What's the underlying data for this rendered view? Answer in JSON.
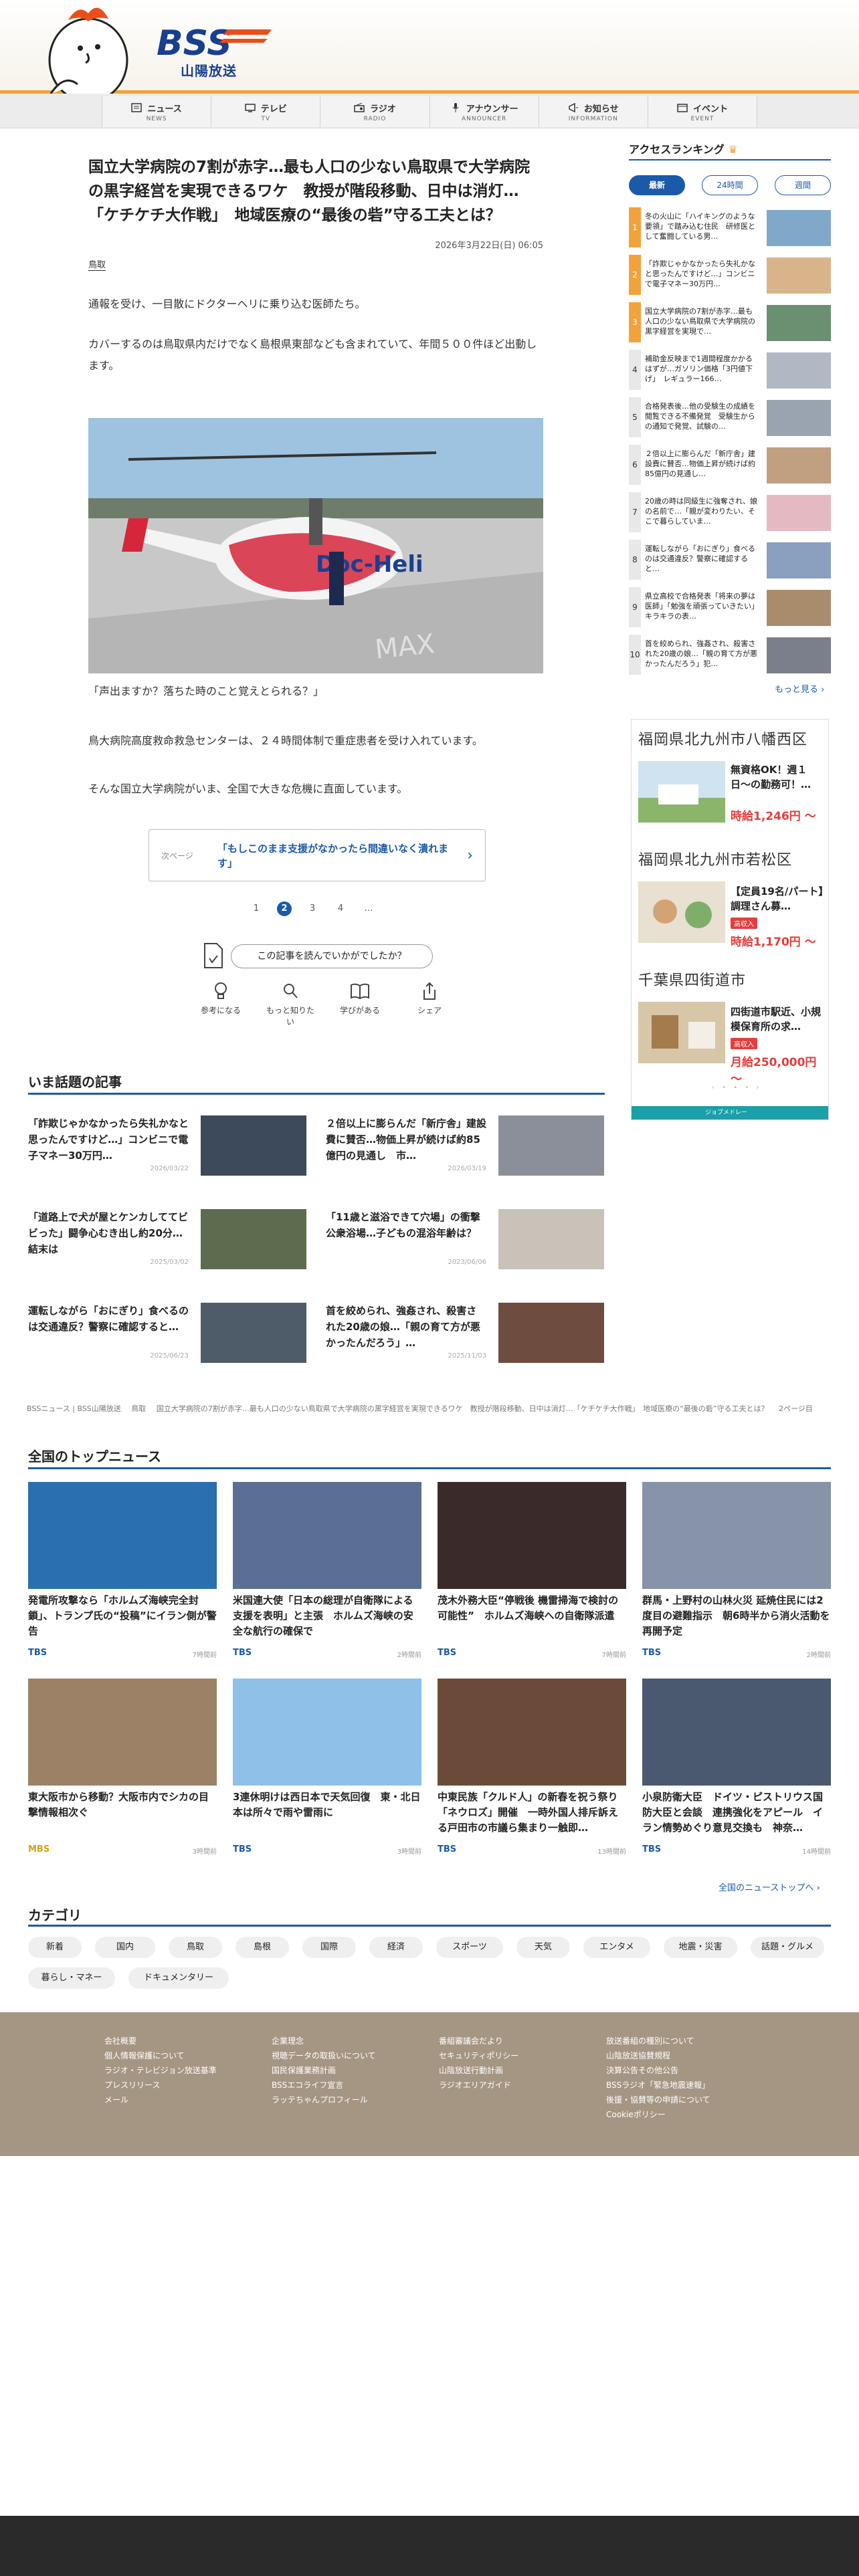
{
  "brand": {
    "station_name": "山陽放送",
    "logo_text": "BSS"
  },
  "nav": {
    "items": [
      {
        "label": "ニュース",
        "sub": "NEWS",
        "icon": "news-icon"
      },
      {
        "label": "テレビ",
        "sub": "TV",
        "icon": "tv-icon"
      },
      {
        "label": "ラジオ",
        "sub": "RADIO",
        "icon": "radio-icon"
      },
      {
        "label": "アナウンサー",
        "sub": "ANNOUNCER",
        "icon": "mic-icon"
      },
      {
        "label": "お知らせ",
        "sub": "INFORMATION",
        "icon": "megaphone-icon"
      },
      {
        "label": "イベント",
        "sub": "EVENT",
        "icon": "calendar-icon"
      }
    ]
  },
  "article": {
    "title": "国立大学病院の7割が赤字…最も人口の少ない鳥取県で大学病院の黒字経営を実現できるワケ　教授が階段移動、日中は消灯…「ケチケチ大作戦」　地域医療の“最後の砦”守る工夫とは？",
    "date": "2026年3月22日(日) 06:05",
    "category": "鳥取",
    "paragraphs": [
      "通報を受け、一目散にドクターヘリに乗り込む医師たち。",
      "カバーするのは鳥取県内だけでなく島根県東部なども含まれていて、年間５００件ほど出動します。"
    ],
    "caption": "「声出ますか？落ちた時のこと覚えとられる？」",
    "paragraphs2": [
      "鳥大病院高度救命救急センターは、２４時間体制で重症患者を受け入れています。",
      "そんな国立大学病院がいま、全国で大きな危機に直面しています。"
    ],
    "next_label": "次ページ",
    "next_text": "「もしこのまま支援がなかったら間違いなく潰れます」",
    "pages": [
      "1",
      "2",
      "3",
      "4",
      "…"
    ],
    "current_page": 2,
    "feedback_prompt": "この記事を読んでいかがでしたか？",
    "reactions": [
      "参考になる",
      "もっと知りたい",
      "学びがある",
      "シェア"
    ]
  },
  "ranking": {
    "title": "アクセスランキング",
    "tabs": [
      "最新",
      "24時間",
      "週間"
    ],
    "active_tab": "最新",
    "items": [
      {
        "rank": "1",
        "text": "冬の火山に「ハイキングのような要領」で踏み込む住民　研修医として奮闘している男…",
        "color": "#f2a23a"
      },
      {
        "rank": "2",
        "text": "「詐欺じゃかなかったら失礼かなと思ったんですけど…」コンビニで電子マネー30万円…",
        "color": "#f2a23a"
      },
      {
        "rank": "3",
        "text": "国立大学病院の7割が赤字…最も人口の少ない鳥取県で大学病院の黒字経営を実現で…",
        "color": "#f2a23a"
      },
      {
        "rank": "4",
        "text": "補助金反映まで1週間程度かかるはずが…ガソリン価格「3円値下げ」　レギュラー166…",
        "color": "#e8e8e8"
      },
      {
        "rank": "5",
        "text": "合格発表後…他の受験生の成績を閲覧できる不備発覚　受験生からの通知で発覚、試験の…",
        "color": "#e8e8e8"
      },
      {
        "rank": "6",
        "text": "２倍以上に膨らんだ「新庁舎」建設費に賛否…物価上昇が続けば約85億円の見通し…",
        "color": "#e8e8e8"
      },
      {
        "rank": "7",
        "text": "20歳の時は同級生に強奪され、娘の名前で…「親が変わりたい、そこで暮らしていま…",
        "color": "#e8e8e8"
      },
      {
        "rank": "8",
        "text": "運転しながら「おにぎり」食べるのは交通違反？警察に確認すると…",
        "color": "#e8e8e8"
      },
      {
        "rank": "9",
        "text": "県立高校で合格発表「将来の夢は医師」「勉強を頑張っていきたい」キラキラの表…",
        "color": "#e8e8e8"
      },
      {
        "rank": "10",
        "text": "首を絞められ、強姦され、殺害された20歳の娘…「親の育て方が悪かったんだろう」犯…",
        "color": "#e8e8e8"
      }
    ],
    "more": "もっと見る ›"
  },
  "ad": {
    "blocks": [
      {
        "head": "福岡県北九州市八幡西区",
        "title": "無資格OK！週１日〜の勤務可！…",
        "badge": "",
        "price": "時給1,246円 〜"
      },
      {
        "head": "福岡県北九州市若松区",
        "title": "【定員19名/パート】調理さん募…",
        "badge": "高収入",
        "price": "時給1,170円 〜"
      },
      {
        "head": "千葉県四街道市",
        "title": "四街道市駅近、小規模保育所の求…",
        "badge": "高収入",
        "price": "月給250,000円 〜"
      }
    ],
    "footer": "ジョブメドレー"
  },
  "topics": {
    "title": "いま話題の記事",
    "items": [
      {
        "title": "「詐欺じゃかなかったら失礼かなと思ったんですけど…」コンビニで電子マネー30万円…",
        "date": "2026/03/22"
      },
      {
        "title": "２倍以上に膨らんだ「新庁舎」建設費に賛否…物価上昇が続けば約85億円の見通し　市…",
        "date": "2026/03/19"
      },
      {
        "title": "「道路上で犬が屋とケンカしててビビった」闘争心むき出し約20分…結末は",
        "date": "2025/03/02"
      },
      {
        "title": "「11歳と滋浴できて穴場」の衝撃　公衆浴場…子どもの混浴年齢は？",
        "date": "2023/06/06"
      },
      {
        "title": "運転しながら「おにぎり」食べるのは交通違反？警察に確認すると…",
        "date": "2025/06/23"
      },
      {
        "title": "首を絞められ、強姦され、殺害された20歳の娘…「親の育て方が悪かったんだろう」…",
        "date": "2025/11/03"
      }
    ]
  },
  "breadcrumb": [
    "BSSニュース | BSS山陽放送",
    "鳥取",
    "国立大学病院の7割が赤字…最も人口の少ない鳥取県で大学病院の黒字経営を実現できるワケ　教授が階段移動、日中は消灯…「ケチケチ大作戦」　地域医療の“最後の砦”守る工夫とは？",
    "2ページ目"
  ],
  "national": {
    "title": "全国のトップニュース",
    "items": [
      {
        "title": "発電所攻撃なら「ホルムズ海峡完全封鎖」、トランプ氏の“投稿”にイラン側が警告",
        "source": "TBS",
        "time": "7時間前"
      },
      {
        "title": "米国連大使「日本の総理が自衛隊による支援を表明」と主張　ホルムズ海峡の安全な航行の確保で",
        "source": "TBS",
        "time": "2時間前"
      },
      {
        "title": "茂木外務大臣“停戦後 機雷掃海で検討の可能性”　ホルムズ海峡への自衛隊派遣",
        "source": "TBS",
        "time": "7時間前"
      },
      {
        "title": "群馬・上野村の山林火災 延焼住民には2度目の避難指示　朝6時半から消火活動を再開予定",
        "source": "TBS",
        "time": "2時間前"
      },
      {
        "title": "東大阪市から移動？大阪市内でシカの目撃情報相次ぐ",
        "source": "MBS",
        "time": "3時間前"
      },
      {
        "title": "3連休明けは西日本で天気回復　東・北日本は所々で雨や雷雨に",
        "source": "TBS",
        "time": "3時間前"
      },
      {
        "title": "中東民族「クルド人」の新春を祝う祭り「ネウロズ」開催　一時外国人排斥訴える戸田市の市議ら集まり一触即…",
        "source": "TBS",
        "time": "13時間前"
      },
      {
        "title": "小泉防衛大臣　ドイツ・ピストリウス国防大臣と会談　連携強化をアピール　イラン情勢めぐり意見交換も　神奈…",
        "source": "TBS",
        "time": "14時間前"
      }
    ],
    "more": "全国のニューストップへ ›"
  },
  "categories": {
    "title": "カテゴリ",
    "items": [
      "新着",
      "国内",
      "鳥取",
      "島根",
      "国際",
      "経済",
      "スポーツ",
      "天気",
      "エンタメ",
      "地震・災害",
      "話題・グルメ",
      "暮らし・マネー",
      "ドキュメンタリー"
    ]
  },
  "footer": {
    "col1": [
      "会社概要",
      "個人情報保護について",
      "ラジオ・テレビジョン放送基準",
      "プレスリリース",
      "メール"
    ],
    "col2": [
      "企業理念",
      "視聴データの取扱いについて",
      "国民保護業務計画",
      "BSSエコライフ宣言",
      "ラッテちゃんプロフィール"
    ],
    "col3": [
      "番組審議会だより",
      "セキュリティポリシー",
      "山陰放送行動計画",
      "ラジオエリアガイド"
    ],
    "col4": [
      "放送番組の種別について",
      "山陰放送協賛規程",
      "決算公告その他公告",
      "BSSラジオ「緊急地震速報」",
      "後援・協賛等の申請について",
      "Cookieポリシー"
    ]
  },
  "colors": {
    "accent": "#1a5aa8",
    "orange": "#f2a23a",
    "footer": "#a59683",
    "ad_red": "#e53e3e"
  }
}
